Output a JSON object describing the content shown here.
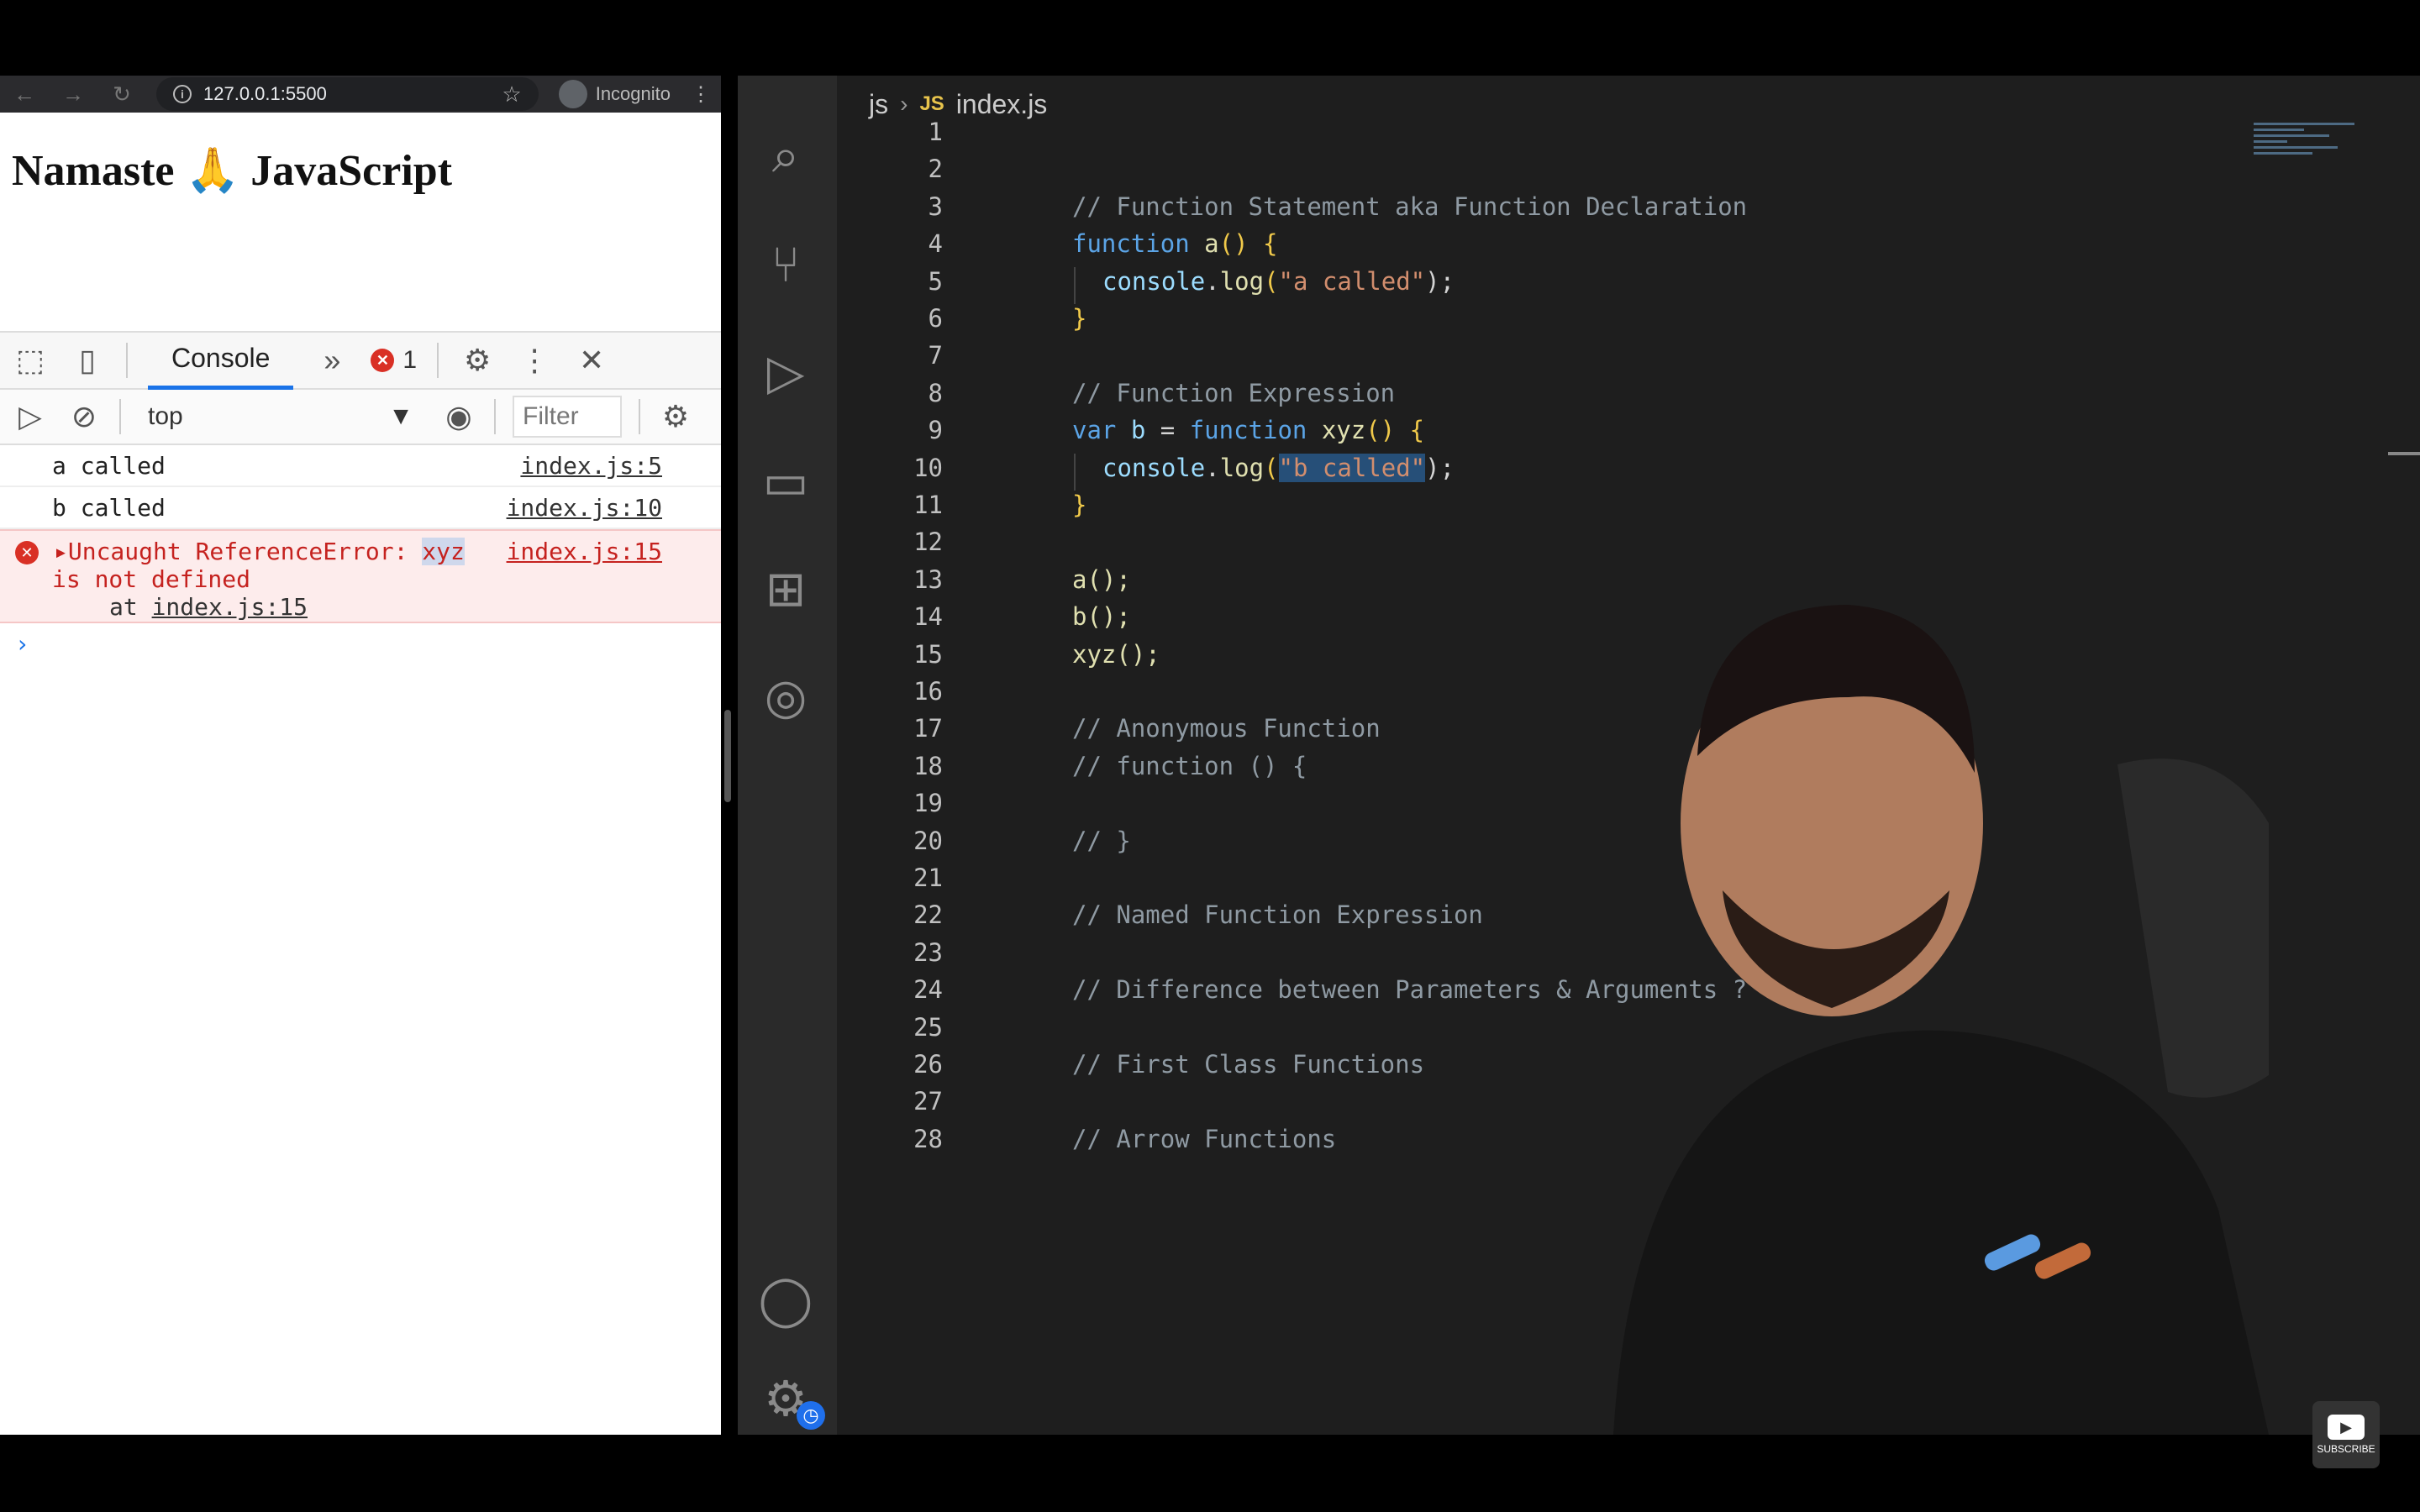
{
  "browser": {
    "url": "127.0.0.1:5500",
    "incognito_label": "Incognito",
    "page_heading": "Namaste ",
    "page_heading_emoji": "🙏",
    "page_heading_rest": " JavaScript"
  },
  "devtools": {
    "tab_console": "Console",
    "more_tabs": "»",
    "error_count": "1",
    "context": "top",
    "filter_placeholder": "Filter",
    "logs": [
      {
        "text": "a called",
        "source": "index.js:5"
      },
      {
        "text": "b called",
        "source": "index.js:10"
      }
    ],
    "error": {
      "prefix": "Uncaught ReferenceError: ",
      "highlight": "xyz",
      "source": "index.js:15",
      "line2": "is not defined",
      "at_label": "at ",
      "at_link": "index.js:15"
    },
    "prompt": "›"
  },
  "vscode": {
    "breadcrumb_folder": "js",
    "breadcrumb_file_badge": "JS",
    "breadcrumb_file": "index.js",
    "line_numbers": [
      "1",
      "2",
      "3",
      "4",
      "5",
      "6",
      "7",
      "8",
      "9",
      "10",
      "11",
      "12",
      "13",
      "14",
      "15",
      "16",
      "17",
      "18",
      "19",
      "20",
      "21",
      "22",
      "23",
      "24",
      "25",
      "26",
      "27",
      "28"
    ],
    "code": {
      "l3": "// Function Statement aka Function Declaration",
      "l4_kw": "function",
      "l4_name": " a",
      "l4_rest": "() {",
      "l5_obj": "console",
      "l5_dot": ".",
      "l5_fn": "log",
      "l5_open": "(",
      "l5_str": "\"a called\"",
      "l5_close": ");",
      "l6": "}",
      "l8": "// Function Expression",
      "l9_kw": "var",
      "l9_var": " b ",
      "l9_eq": "= ",
      "l9_kw2": "function",
      "l9_name": " xyz",
      "l9_rest": "() {",
      "l10_obj": "console",
      "l10_dot": ".",
      "l10_fn": "log",
      "l10_open": "(",
      "l10_str": "\"b called\"",
      "l10_close": ");",
      "l11": "}",
      "l13": "a();",
      "l14": "b();",
      "l15": "xyz();",
      "l17": "// Anonymous Function",
      "l18": "// function () {",
      "l20": "// }",
      "l22": "// Named Function Expression",
      "l24": "// Difference between Parameters & Arguments ?",
      "l26": "// First Class Functions",
      "l28": "// Arrow Functions"
    }
  },
  "youtube": {
    "label": "SUBSCRIBE"
  },
  "colors": {
    "accent": "#1a73e8",
    "error": "#d93025",
    "editor_bg": "#1e1e1e",
    "selection": "#264f78"
  }
}
